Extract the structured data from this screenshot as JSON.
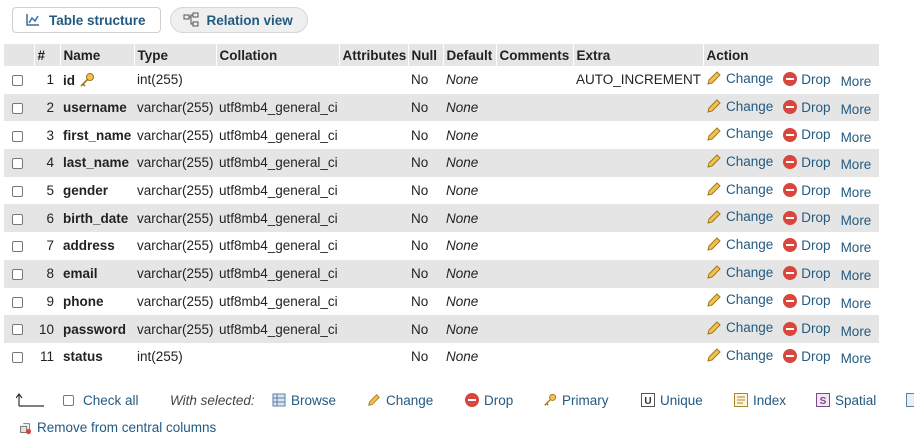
{
  "tabs": {
    "structure": "Table structure",
    "relation": "Relation view"
  },
  "table": {
    "headers": {
      "num": "#",
      "name": "Name",
      "type": "Type",
      "collation": "Collation",
      "attributes": "Attributes",
      "null": "Null",
      "default": "Default",
      "comments": "Comments",
      "extra": "Extra",
      "action": "Action"
    },
    "rows": [
      {
        "num": "1",
        "name": "id",
        "type": "int(255)",
        "collation": "",
        "null": "No",
        "default": "None",
        "extra": "AUTO_INCREMENT"
      },
      {
        "num": "2",
        "name": "username",
        "type": "varchar(255)",
        "collation": "utf8mb4_general_ci",
        "null": "No",
        "default": "None",
        "extra": ""
      },
      {
        "num": "3",
        "name": "first_name",
        "type": "varchar(255)",
        "collation": "utf8mb4_general_ci",
        "null": "No",
        "default": "None",
        "extra": ""
      },
      {
        "num": "4",
        "name": "last_name",
        "type": "varchar(255)",
        "collation": "utf8mb4_general_ci",
        "null": "No",
        "default": "None",
        "extra": ""
      },
      {
        "num": "5",
        "name": "gender",
        "type": "varchar(255)",
        "collation": "utf8mb4_general_ci",
        "null": "No",
        "default": "None",
        "extra": ""
      },
      {
        "num": "6",
        "name": "birth_date",
        "type": "varchar(255)",
        "collation": "utf8mb4_general_ci",
        "null": "No",
        "default": "None",
        "extra": ""
      },
      {
        "num": "7",
        "name": "address",
        "type": "varchar(255)",
        "collation": "utf8mb4_general_ci",
        "null": "No",
        "default": "None",
        "extra": ""
      },
      {
        "num": "8",
        "name": "email",
        "type": "varchar(255)",
        "collation": "utf8mb4_general_ci",
        "null": "No",
        "default": "None",
        "extra": ""
      },
      {
        "num": "9",
        "name": "phone",
        "type": "varchar(255)",
        "collation": "utf8mb4_general_ci",
        "null": "No",
        "default": "None",
        "extra": ""
      },
      {
        "num": "10",
        "name": "password",
        "type": "varchar(255)",
        "collation": "utf8mb4_general_ci",
        "null": "No",
        "default": "None",
        "extra": ""
      },
      {
        "num": "11",
        "name": "status",
        "type": "int(255)",
        "collation": "",
        "null": "No",
        "default": "None",
        "extra": ""
      }
    ],
    "actions": {
      "change": "Change",
      "drop": "Drop",
      "more": "More"
    }
  },
  "footer": {
    "check_all": "Check all",
    "with_selected": "With selected:",
    "browse": "Browse",
    "change": "Change",
    "drop": "Drop",
    "primary": "Primary",
    "unique": "Unique",
    "index": "Index",
    "spatial": "Spatial",
    "remove_central": "Remove from central columns"
  },
  "colors": {
    "link": "#235a81",
    "row_alt": "#e5e5e5",
    "drop_icon": "#d9463b"
  },
  "icons": [
    "structure-icon",
    "relation-icon",
    "primary-key-icon",
    "pencil-icon",
    "drop-icon",
    "browse-icon",
    "unique-icon",
    "index-icon",
    "spatial-icon",
    "central-columns-icon",
    "arrow-up-icon"
  ]
}
